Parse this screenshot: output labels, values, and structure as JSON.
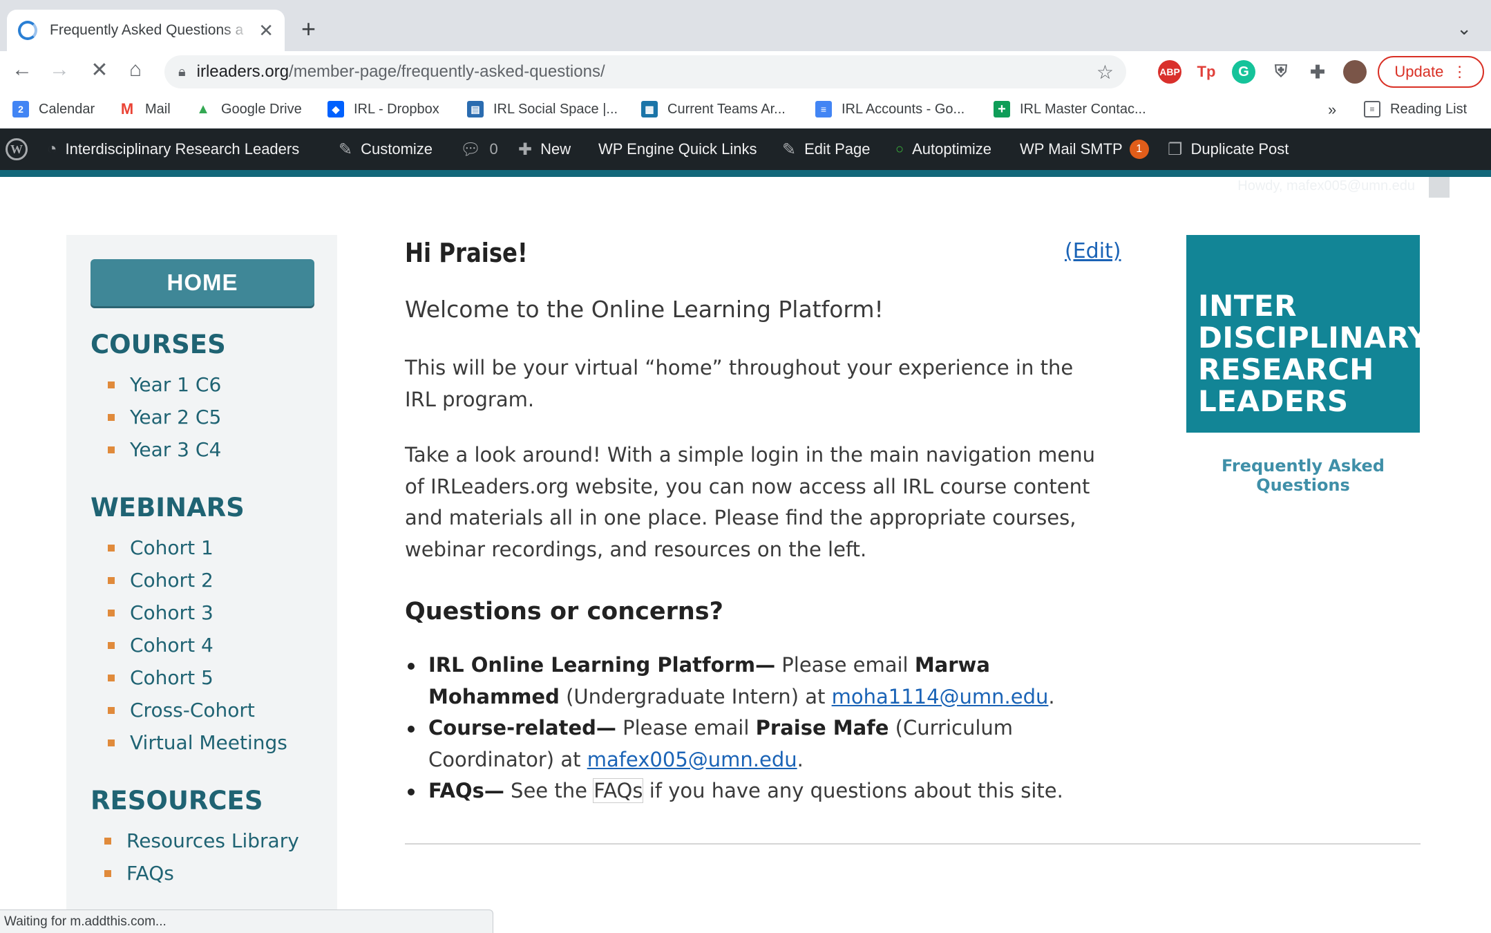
{
  "browser": {
    "tab_title": "Frequently Asked Questions a",
    "new_tab": "+",
    "url_host": "irleaders.org",
    "url_path": "/member-page/frequently-asked-questions/",
    "update_label": "Update",
    "reading_list": "Reading List",
    "more_bookmarks": "»",
    "status_text": "Waiting for m.addthis.com..."
  },
  "bookmarks": [
    {
      "label": "Calendar",
      "icon": "calendar-icon",
      "color": "#4285f4",
      "glyph": "2"
    },
    {
      "label": "Mail",
      "icon": "gmail-icon",
      "color": "#ea4335",
      "glyph": "M"
    },
    {
      "label": "Google Drive",
      "icon": "drive-icon",
      "color": "#34a853",
      "glyph": "▲"
    },
    {
      "label": "IRL - Dropbox",
      "icon": "dropbox-icon",
      "color": "#0061fe",
      "glyph": "◆"
    },
    {
      "label": "IRL Social Space |...",
      "icon": "doc-icon",
      "color": "#2b6cb0",
      "glyph": "▤"
    },
    {
      "label": "Current Teams Ar...",
      "icon": "folder-icon",
      "color": "#1b75a8",
      "glyph": "▦"
    },
    {
      "label": "IRL Accounts - Go...",
      "icon": "google-docs-icon",
      "color": "#4285f4",
      "glyph": "≡"
    },
    {
      "label": "IRL Master Contac...",
      "icon": "google-sheets-icon",
      "color": "#0f9d58",
      "glyph": "+"
    }
  ],
  "admin_bar": {
    "site_name": "Interdisciplinary Research Leaders",
    "customize": "Customize",
    "comments_count": "0",
    "new_label": "New",
    "wp_engine": "WP Engine Quick Links",
    "edit_page": "Edit Page",
    "autoptimize": "Autoptimize",
    "wp_mail_smtp": "WP Mail SMTP",
    "smtp_badge": "1",
    "duplicate_post": "Duplicate Post",
    "howdy": "Howdy, mafex005@umn.edu"
  },
  "sidebar": {
    "home": "HOME",
    "courses_heading": "COURSES",
    "courses": [
      "Year 1 C6",
      "Year 2 C5",
      "Year 3 C4"
    ],
    "webinars_heading": "WEBINARS",
    "webinars": [
      "Cohort 1",
      "Cohort 2",
      "Cohort 3",
      "Cohort 4",
      "Cohort 5",
      "Cross-Cohort",
      "Virtual Meetings"
    ],
    "resources_heading": "RESOURCES",
    "resources": [
      "Resources Library",
      "FAQs"
    ]
  },
  "main": {
    "greeting": "Hi Praise!",
    "edit": "(Edit)",
    "welcome": "Welcome to the Online Learning Platform!",
    "para1": "This will be your virtual “home” throughout your experience in the IRL program.",
    "para2": "Take a look around! With a simple login in the main navigation menu of IRLeaders.org website, you can now access all IRL course content and materials all in one place. Please find the appropriate courses, webinar recordings, and resources on the left.",
    "questions_heading": "Questions or concerns?",
    "contacts": [
      {
        "label": "IRL Online Learning Platform—",
        "pre": " Please email ",
        "name": "Marwa Mohammed",
        "role": " (Undergraduate Intern) at ",
        "email": "moha1114@umn.edu",
        "end": "."
      },
      {
        "label": "Course-related—",
        "pre": " Please email ",
        "name": "Praise Mafe",
        "role": " (Curriculum Coordinator) at ",
        "email": "mafex005@umn.edu",
        "end": "."
      }
    ],
    "faq": {
      "label": "FAQs—",
      "pre": " See the ",
      "link": "FAQs",
      "post": " if you have any questions about this site."
    }
  },
  "logo": {
    "lines": [
      "INTER",
      "DISCIPLINARY",
      "RESEARCH",
      "LEADERS"
    ],
    "caption": "Frequently Asked Questions",
    "color": "#128596"
  }
}
